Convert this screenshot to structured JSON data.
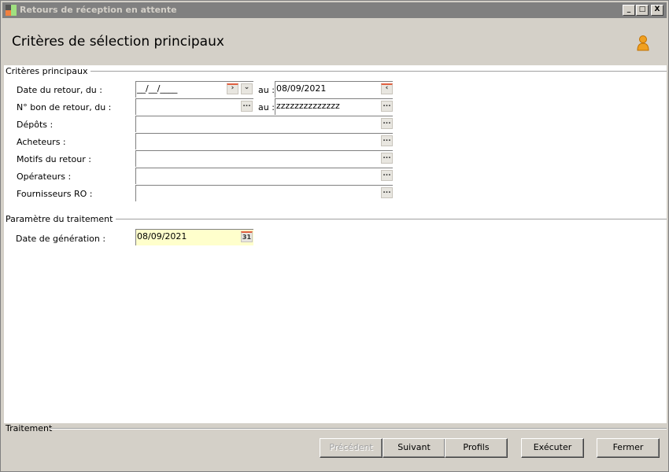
{
  "window": {
    "title": "Retours de réception en attente",
    "controls": [
      "_",
      "□",
      "X"
    ]
  },
  "header": {
    "title": "Critères de sélection principaux"
  },
  "groups": {
    "main": "Critères principaux",
    "params": "Paramètre du traitement",
    "footer": "Traitement"
  },
  "fields": {
    "date_retour": {
      "label": "Date du retour, du :",
      "from": "__/__/____",
      "to_label": "au :",
      "to": "08/09/2021"
    },
    "bon_retour": {
      "label": "N° bon de retour, du :",
      "from": "",
      "to_label": "au :",
      "to": "zzzzzzzzzzzzzz"
    },
    "depots": {
      "label": "Dépôts :",
      "value": ""
    },
    "acheteurs": {
      "label": "Acheteurs :",
      "value": ""
    },
    "motifs": {
      "label": "Motifs du retour  :",
      "value": ""
    },
    "operateurs": {
      "label": "Opérateurs :",
      "value": ""
    },
    "fournisseurs": {
      "label": "Fournisseurs RO :",
      "value": ""
    },
    "date_generation": {
      "label": "Date de génération :",
      "value": "08/09/2021",
      "calendar_day": "31"
    }
  },
  "buttons": {
    "precedent": "Précédent",
    "suivant": "Suivant",
    "profils": "Profils",
    "executer": "Exécuter",
    "fermer": "Fermer"
  },
  "colors": {
    "titlebar": "#808080",
    "panel": "#d4d0c8",
    "highlight_field": "#ffffcc"
  }
}
